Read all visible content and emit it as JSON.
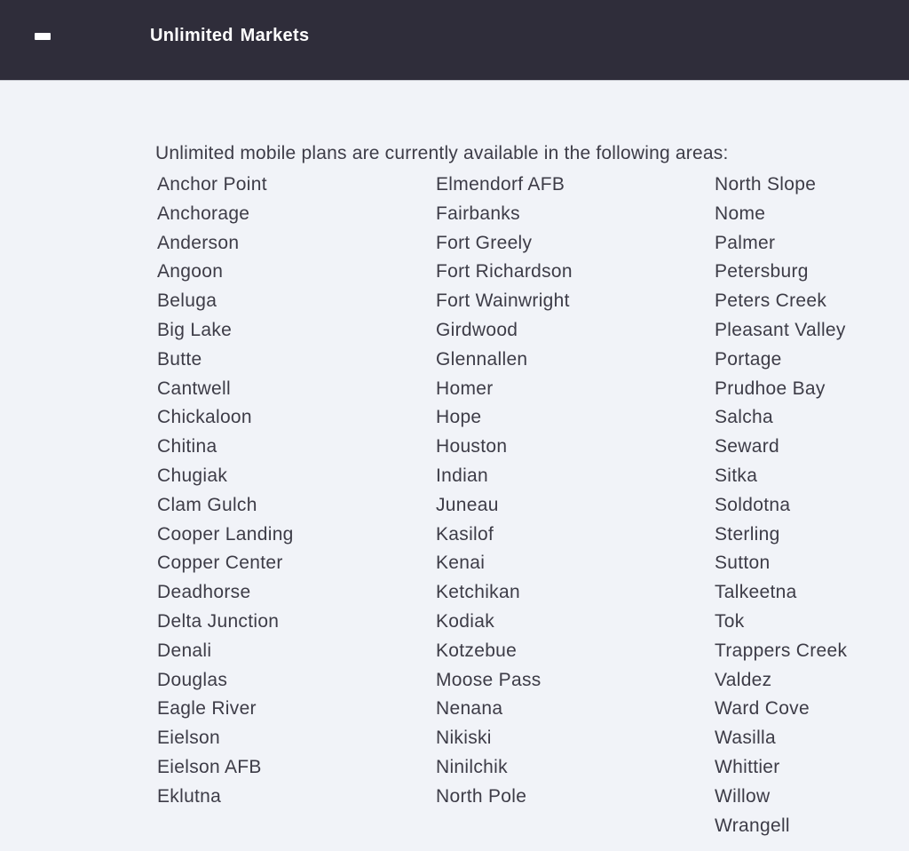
{
  "header": {
    "icon": "minus-icon",
    "title": "Unlimited Markets"
  },
  "colors": {
    "header_bg": "#2f2d3a",
    "header_text": "#ffffff",
    "content_bg": "#f1f3f8",
    "body_text": "#3d3c47"
  },
  "content": {
    "intro": "Unlimited mobile plans are currently available in the following areas:",
    "columns": [
      [
        "Anchor Point",
        "Anchorage",
        "Anderson",
        "Angoon",
        "Beluga",
        "Big Lake",
        "Butte",
        "Cantwell",
        "Chickaloon",
        "Chitina",
        "Chugiak",
        "Clam Gulch",
        "Cooper Landing",
        "Copper Center",
        "Deadhorse",
        "Delta Junction",
        "Denali",
        "Douglas",
        "Eagle River",
        "Eielson",
        "Eielson AFB",
        "Eklutna"
      ],
      [
        "Elmendorf AFB",
        "Fairbanks",
        "Fort Greely",
        "Fort Richardson",
        "Fort Wainwright",
        "Girdwood",
        "Glennallen",
        "Homer",
        "Hope",
        "Houston",
        "Indian",
        "Juneau",
        "Kasilof",
        "Kenai",
        "Ketchikan",
        "Kodiak",
        "Kotzebue",
        "Moose Pass",
        "Nenana",
        "Nikiski",
        "Ninilchik",
        "North Pole"
      ],
      [
        "North Slope",
        "Nome",
        "Palmer",
        "Petersburg",
        "Peters Creek",
        "Pleasant Valley",
        "Portage",
        "Prudhoe Bay",
        "Salcha",
        "Seward",
        "Sitka",
        "Soldotna",
        "Sterling",
        "Sutton",
        "Talkeetna",
        "Tok",
        "Trappers Creek",
        "Valdez",
        "Ward Cove",
        "Wasilla",
        "Whittier",
        "Willow",
        "Wrangell"
      ]
    ]
  }
}
